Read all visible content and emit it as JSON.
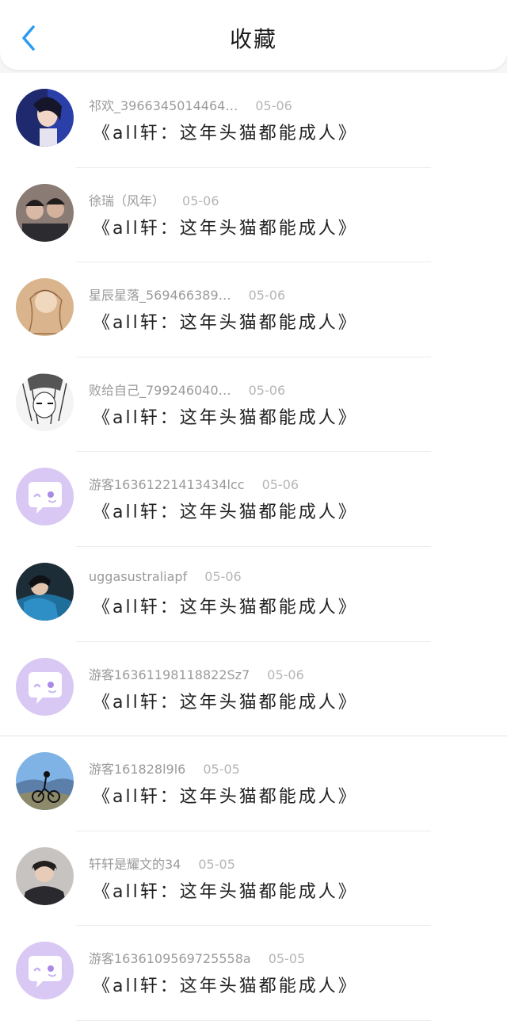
{
  "header": {
    "title": "收藏",
    "back_icon": "chevron-left-icon",
    "accent_color": "#2d9cf0"
  },
  "items": [
    {
      "author": "祁欢_3966345014464…",
      "date": "05-06",
      "title": "《all轩：这年头猫都能成人》",
      "avatar_icon": "avatar-photo-icon"
    },
    {
      "author": "徐瑞（风年）",
      "date": "05-06",
      "title": "《all轩：这年头猫都能成人》",
      "avatar_icon": "avatar-photo-icon"
    },
    {
      "author": "星辰星落_569466389…",
      "date": "05-06",
      "title": "《all轩：这年头猫都能成人》",
      "avatar_icon": "avatar-photo-icon"
    },
    {
      "author": "败给自己_799246040…",
      "date": "05-06",
      "title": "《all轩：这年头猫都能成人》",
      "avatar_icon": "avatar-photo-icon"
    },
    {
      "author": "游客16361221413434lcc",
      "date": "05-06",
      "title": "《all轩：这年头猫都能成人》",
      "avatar_icon": "default-chat-avatar-icon"
    },
    {
      "author": "uggasustraliapf",
      "date": "05-06",
      "title": "《all轩：这年头猫都能成人》",
      "avatar_icon": "avatar-photo-icon"
    },
    {
      "author": "游客16361198118822Sz7",
      "date": "05-06",
      "title": "《all轩：这年头猫都能成人》",
      "avatar_icon": "default-chat-avatar-icon"
    },
    {
      "author": "游客161828l9l6",
      "date": "05-05",
      "title": "《all轩：这年头猫都能成人》",
      "avatar_icon": "avatar-photo-icon"
    },
    {
      "author": "轩轩是耀文的34",
      "date": "05-05",
      "title": "《all轩：这年头猫都能成人》",
      "avatar_icon": "avatar-photo-icon"
    },
    {
      "author": "游客1636109569725558a",
      "date": "05-05",
      "title": "《all轩：这年头猫都能成人》",
      "avatar_icon": "default-chat-avatar-icon"
    }
  ],
  "colors": {
    "default_avatar_bg": "#d9c8f3",
    "meta_text": "#9a9a9a",
    "title_text": "#222222"
  }
}
